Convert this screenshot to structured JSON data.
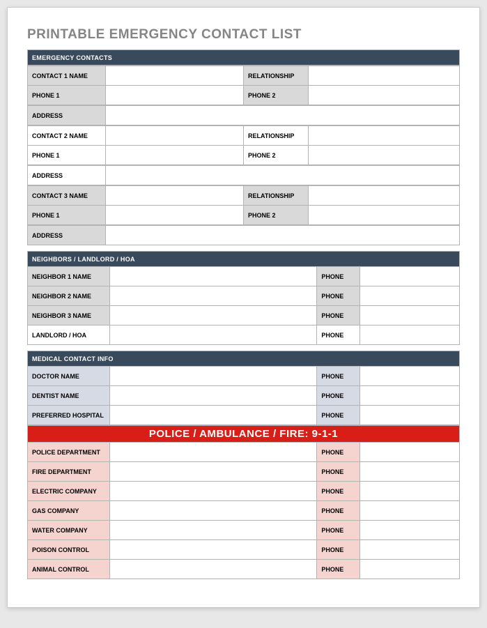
{
  "title": "PRINTABLE EMERGENCY CONTACT LIST",
  "emergency": {
    "header": "EMERGENCY CONTACTS",
    "contacts": [
      {
        "nameLabel": "CONTACT 1 NAME",
        "relLabel": "RELATIONSHIP",
        "phone1Label": "PHONE 1",
        "phone2Label": "PHONE 2",
        "addressLabel": "ADDRESS",
        "tint": "gray"
      },
      {
        "nameLabel": "CONTACT 2 NAME",
        "relLabel": "RELATIONSHIP",
        "phone1Label": "PHONE 1",
        "phone2Label": "PHONE 2",
        "addressLabel": "ADDRESS",
        "tint": "white"
      },
      {
        "nameLabel": "CONTACT 3 NAME",
        "relLabel": "RELATIONSHIP",
        "phone1Label": "PHONE 1",
        "phone2Label": "PHONE 2",
        "addressLabel": "ADDRESS",
        "tint": "gray"
      }
    ]
  },
  "neighbors": {
    "header": "NEIGHBORS / LANDLORD / HOA",
    "rows": [
      {
        "label": "NEIGHBOR 1 NAME",
        "phone": "PHONE",
        "tint": "gray"
      },
      {
        "label": "NEIGHBOR 2 NAME",
        "phone": "PHONE",
        "tint": "gray"
      },
      {
        "label": "NEIGHBOR 3 NAME",
        "phone": "PHONE",
        "tint": "gray"
      },
      {
        "label": "LANDLORD / HOA",
        "phone": "PHONE",
        "tint": "white"
      }
    ]
  },
  "medical": {
    "header": "MEDICAL CONTACT INFO",
    "rows": [
      {
        "label": "DOCTOR NAME",
        "phone": "PHONE"
      },
      {
        "label": "DENTIST NAME",
        "phone": "PHONE"
      },
      {
        "label": "PREFERRED HOSPITAL",
        "phone": "PHONE"
      }
    ]
  },
  "services": {
    "header": "POLICE / AMBULANCE / FIRE:  9-1-1",
    "rows": [
      {
        "label": "POLICE DEPARTMENT",
        "phone": "PHONE"
      },
      {
        "label": "FIRE DEPARTMENT",
        "phone": "PHONE"
      },
      {
        "label": "ELECTRIC COMPANY",
        "phone": "PHONE"
      },
      {
        "label": "GAS COMPANY",
        "phone": "PHONE"
      },
      {
        "label": "WATER COMPANY",
        "phone": "PHONE"
      },
      {
        "label": "POISON CONTROL",
        "phone": "PHONE"
      },
      {
        "label": "ANIMAL CONTROL",
        "phone": "PHONE"
      }
    ]
  }
}
